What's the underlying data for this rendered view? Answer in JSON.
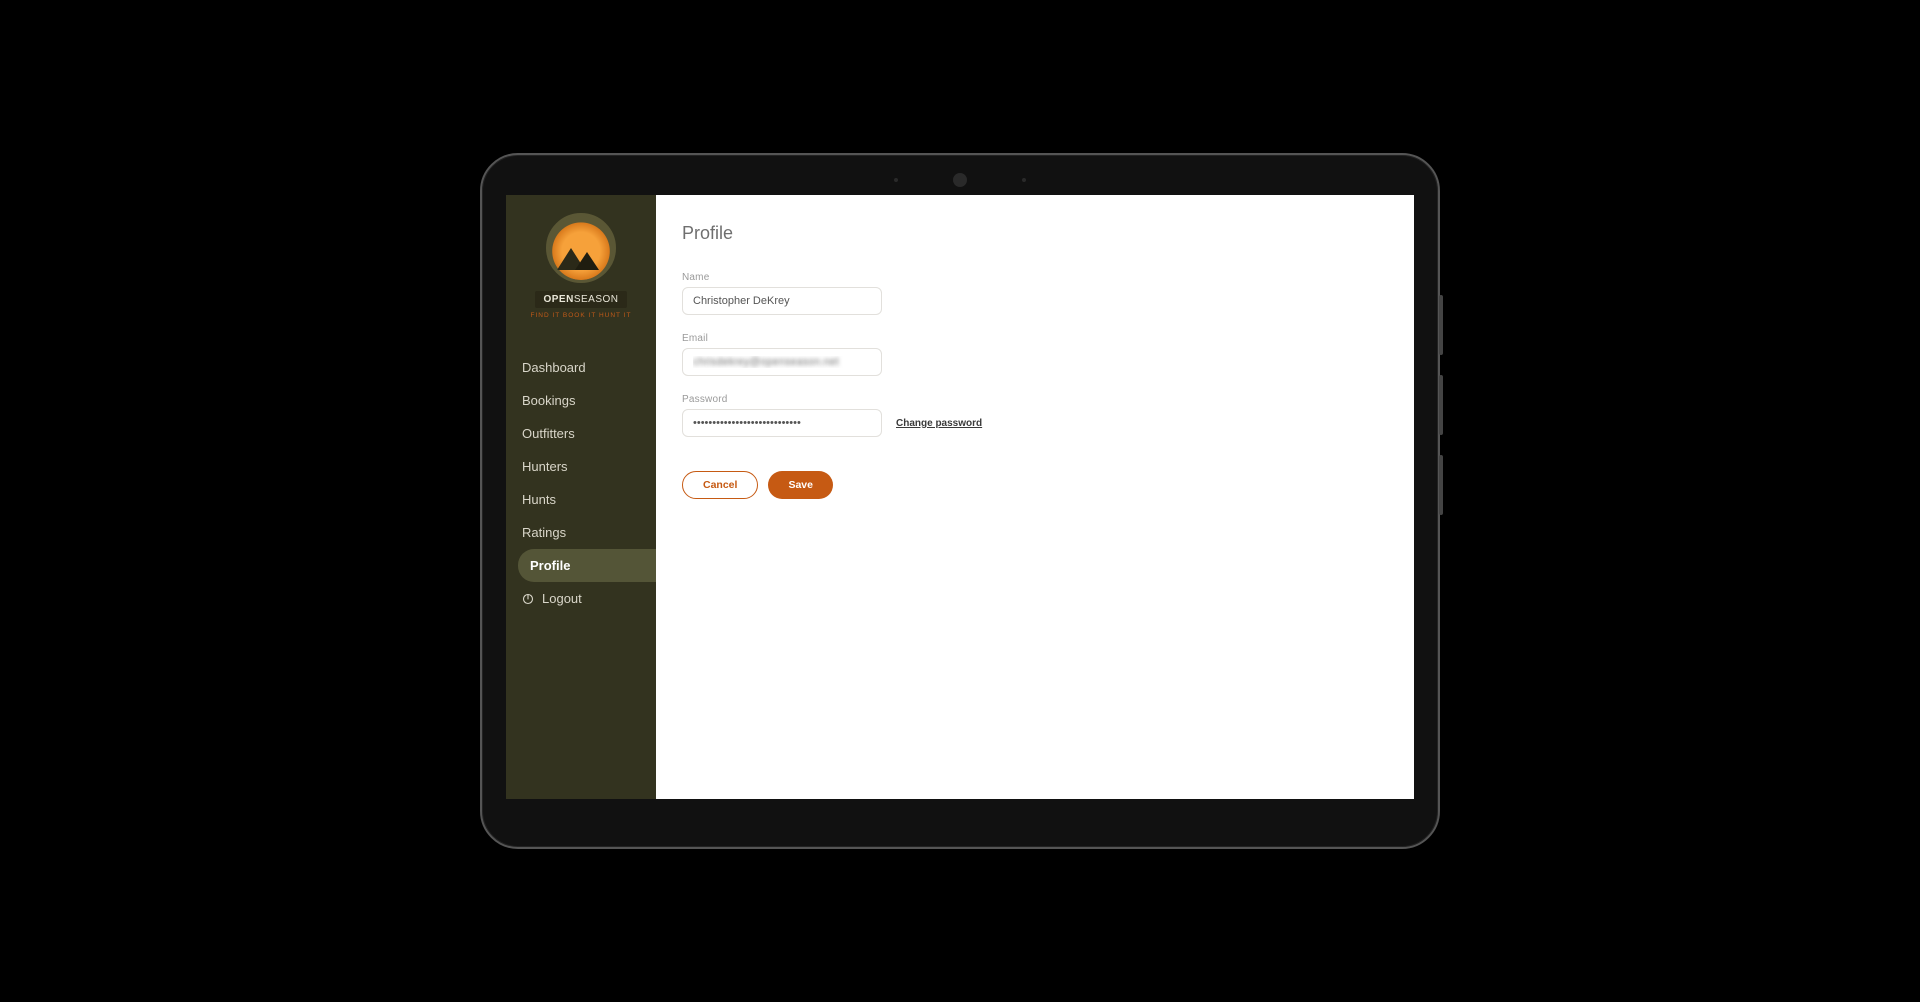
{
  "brand": {
    "name_bold": "OPEN",
    "name_light": "SEASON",
    "tagline": "FIND IT   BOOK IT   HUNT IT"
  },
  "sidebar": {
    "items": [
      {
        "label": "Dashboard",
        "active": false
      },
      {
        "label": "Bookings",
        "active": false
      },
      {
        "label": "Outfitters",
        "active": false
      },
      {
        "label": "Hunters",
        "active": false
      },
      {
        "label": "Hunts",
        "active": false
      },
      {
        "label": "Ratings",
        "active": false
      },
      {
        "label": "Profile",
        "active": true
      },
      {
        "label": "Logout",
        "active": false,
        "icon": "logout"
      }
    ]
  },
  "page": {
    "title": "Profile",
    "fields": {
      "name": {
        "label": "Name",
        "value": "Christopher DeKrey"
      },
      "email": {
        "label": "Email",
        "value": "chrisdekrey@openseason.net"
      },
      "password": {
        "label": "Password",
        "value": "••••••••••••••••••••••••••••"
      }
    },
    "links": {
      "change_password": "Change password"
    },
    "buttons": {
      "cancel": "Cancel",
      "save": "Save"
    }
  },
  "colors": {
    "sidebar_bg": "#33331f",
    "sidebar_active": "#545537",
    "accent": "#c65a13"
  }
}
